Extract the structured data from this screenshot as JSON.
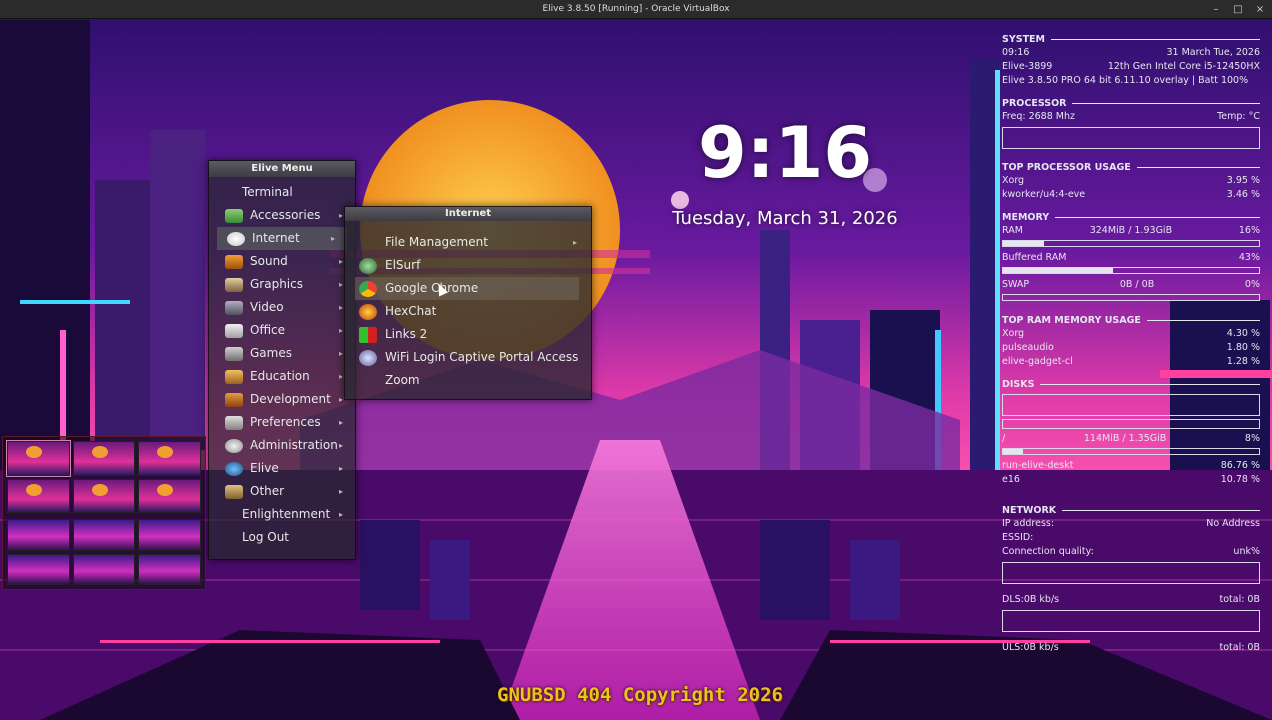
{
  "host": {
    "title": "Elive 3.8.50 [Running] - Oracle VirtualBox",
    "controls": [
      "–",
      "□",
      "×"
    ]
  },
  "clock": {
    "time": "9:16",
    "date": "Tuesday, March 31, 2026"
  },
  "menu": {
    "title": "Elive Menu",
    "items": [
      {
        "label": "Terminal",
        "icon": "",
        "submenu": false
      },
      {
        "label": "Accessories",
        "icon": "accessories-icon",
        "submenu": true
      },
      {
        "label": "Internet",
        "icon": "internet-icon",
        "submenu": true
      },
      {
        "label": "Sound",
        "icon": "sound-icon",
        "submenu": true
      },
      {
        "label": "Graphics",
        "icon": "graphics-icon",
        "submenu": true
      },
      {
        "label": "Video",
        "icon": "video-icon",
        "submenu": true
      },
      {
        "label": "Office",
        "icon": "office-icon",
        "submenu": true
      },
      {
        "label": "Games",
        "icon": "games-icon",
        "submenu": true
      },
      {
        "label": "Education",
        "icon": "education-icon",
        "submenu": true
      },
      {
        "label": "Development",
        "icon": "development-icon",
        "submenu": true
      },
      {
        "label": "Preferences",
        "icon": "preferences-icon",
        "submenu": true
      },
      {
        "label": "Administration",
        "icon": "administration-icon",
        "submenu": true
      },
      {
        "label": "Elive",
        "icon": "elive-icon",
        "submenu": true
      },
      {
        "label": "Other",
        "icon": "other-icon",
        "submenu": true
      },
      {
        "label": "Enlightenment",
        "icon": "",
        "submenu": true
      },
      {
        "label": "Log Out",
        "icon": "",
        "submenu": false
      }
    ]
  },
  "submenu": {
    "title": "Internet",
    "items": [
      {
        "label": "File Management",
        "icon": "",
        "submenu": true
      },
      {
        "label": "ElSurf",
        "icon": "elsurf-icon",
        "submenu": false
      },
      {
        "label": "Google Chrome",
        "icon": "chrome-icon",
        "submenu": false
      },
      {
        "label": "HexChat",
        "icon": "hexchat-icon",
        "submenu": false
      },
      {
        "label": "Links 2",
        "icon": "links-icon",
        "submenu": false
      },
      {
        "label": "WiFi Login Captive Portal Access",
        "icon": "wifi-icon",
        "submenu": false
      },
      {
        "label": "Zoom",
        "icon": "",
        "submenu": false
      }
    ]
  },
  "conky": {
    "system": {
      "header": "SYSTEM",
      "time": "09:16",
      "date": "31 March Tue, 2026",
      "host": "Elive-3899",
      "cpu": "12th Gen Intel Core i5-12450HX",
      "os": "Elive 3.8.50 PRO 64 bit 6.11.10  overlay | Batt 100%"
    },
    "processor": {
      "header": "PROCESSOR",
      "freq": "Freq: 2688 Mhz",
      "temp": "Temp:  °C"
    },
    "top_cpu": {
      "header": "TOP PROCESSOR USAGE",
      "rows": [
        {
          "name": "Xorg",
          "value": "3.95 %"
        },
        {
          "name": "kworker/u4:4-eve",
          "value": "3.46 %"
        }
      ]
    },
    "memory": {
      "header": "MEMORY",
      "ram_label": "RAM",
      "ram_value": "324MiB / 1.93GiB",
      "ram_pct": "16%",
      "ram_fraction": 0.16,
      "buffered_label": "Buffered RAM",
      "buffered_pct": "43%",
      "buffered_fraction": 0.43,
      "swap_label": "SWAP",
      "swap_value": "0B / 0B",
      "swap_pct": "0%"
    },
    "top_ram": {
      "header": "TOP RAM MEMORY USAGE",
      "rows": [
        {
          "name": "Xorg",
          "value": "4.30 %"
        },
        {
          "name": "pulseaudio",
          "value": "1.80 %"
        },
        {
          "name": "elive-gadget-cl",
          "value": "1.28 %"
        }
      ]
    },
    "disks": {
      "header": "DISKS",
      "root_label": "/",
      "root_value": "114MiB / 1.35GiB",
      "root_pct": "8%",
      "root_fraction": 0.08,
      "rows": [
        {
          "name": "run-elive-deskt",
          "value": "86.76 %"
        },
        {
          "name": "e16",
          "value": "10.78 %"
        }
      ]
    },
    "network": {
      "header": "NETWORK",
      "ip_label": "IP address:",
      "ip_value": "No Address",
      "essid_label": "ESSID:",
      "quality_label": "Connection quality:",
      "quality_value": "unk%",
      "dl_label": "DLS:0B kb/s",
      "dl_total": "total: 0B",
      "ul_label": "ULS:0B kb/s",
      "ul_total": "total: 0B"
    }
  },
  "footer": "GNUBSD 404 Copyright 2026",
  "colors": {
    "accent_magenta": "#e0309a",
    "footer_gold": "#f0c020",
    "menu_bg": "#28282f"
  }
}
